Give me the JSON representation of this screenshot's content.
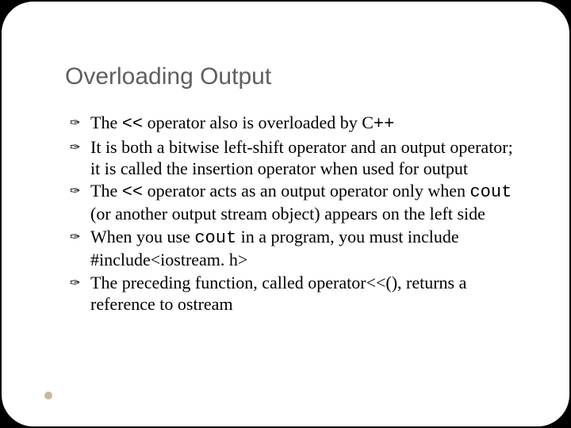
{
  "title": "Overloading Output",
  "bullets": [
    {
      "prefix": "The ",
      "code1": "<<",
      "mid1": " operator also is overloaded by C",
      "code2": "++",
      "suffix": ""
    },
    {
      "prefix": "It is both a bitwise left-shift operator and an output operator; it is called the insertion operator when used for output",
      "code1": "",
      "mid1": "",
      "code2": "",
      "suffix": ""
    },
    {
      "prefix": "The ",
      "code1": "<<",
      "mid1": " operator acts as an output operator only when ",
      "code2": "cout",
      "suffix": " (or another output stream object) appears on the left side"
    },
    {
      "prefix": "When you use ",
      "code1": "cout",
      "mid1": " in a program, you must include #include<iostream. h>",
      "code2": "",
      "suffix": ""
    },
    {
      "prefix": "The preceding function, called operator<<(), returns a reference to ostream",
      "code1": "",
      "mid1": "",
      "code2": "",
      "suffix": ""
    }
  ]
}
